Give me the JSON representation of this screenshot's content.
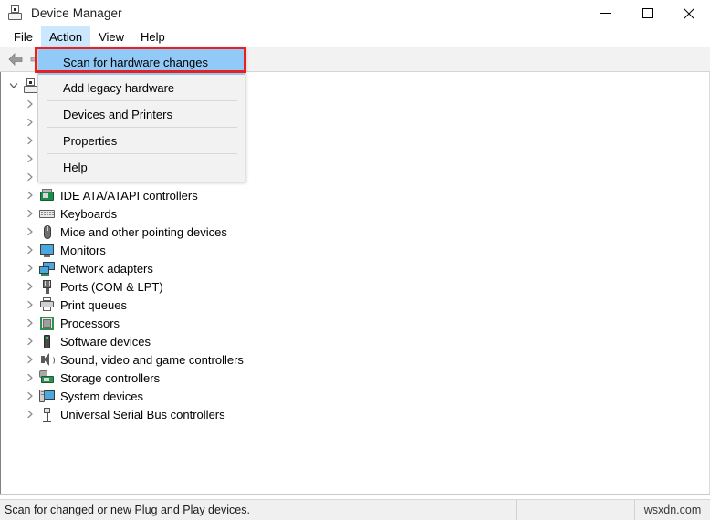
{
  "window": {
    "title": "Device Manager",
    "icon": "device-manager-icon",
    "controls": {
      "minimize": "Minimize",
      "maximize": "Maximize",
      "close": "Close"
    }
  },
  "menubar": {
    "items": [
      {
        "label": "File",
        "active": false
      },
      {
        "label": "Action",
        "active": true
      },
      {
        "label": "View",
        "active": false
      },
      {
        "label": "Help",
        "active": false
      }
    ]
  },
  "toolbar": {
    "buttons": [
      {
        "name": "back-button",
        "icon": "back-arrow-icon"
      },
      {
        "name": "forward-button",
        "icon": "forward-arrow-icon"
      }
    ]
  },
  "dropdown": {
    "owner": "Action",
    "items": [
      {
        "label": "Scan for hardware changes",
        "highlighted": true,
        "separator_after": false
      },
      {
        "label": "Add legacy hardware",
        "highlighted": false,
        "separator_after": true
      },
      {
        "label": "Devices and Printers",
        "highlighted": false,
        "separator_after": true
      },
      {
        "label": "Properties",
        "highlighted": false,
        "separator_after": true
      },
      {
        "label": "Help",
        "highlighted": false,
        "separator_after": false
      }
    ],
    "annotation_color": "#e8201f",
    "highlight_color": "#91c9f7"
  },
  "tree": {
    "root": {
      "label": "",
      "icon": "computer-icon",
      "expanded": true
    },
    "hidden_rows": 5,
    "items": [
      {
        "label": "IDE ATA/ATAPI controllers",
        "icon": "ide-controller-icon"
      },
      {
        "label": "Keyboards",
        "icon": "keyboard-icon"
      },
      {
        "label": "Mice and other pointing devices",
        "icon": "mouse-icon"
      },
      {
        "label": "Monitors",
        "icon": "monitor-icon"
      },
      {
        "label": "Network adapters",
        "icon": "network-adapter-icon"
      },
      {
        "label": "Ports (COM & LPT)",
        "icon": "port-icon"
      },
      {
        "label": "Print queues",
        "icon": "printer-icon"
      },
      {
        "label": "Processors",
        "icon": "processor-icon"
      },
      {
        "label": "Software devices",
        "icon": "software-device-icon"
      },
      {
        "label": "Sound, video and game controllers",
        "icon": "sound-icon"
      },
      {
        "label": "Storage controllers",
        "icon": "storage-controller-icon"
      },
      {
        "label": "System devices",
        "icon": "system-device-icon"
      },
      {
        "label": "Universal Serial Bus controllers",
        "icon": "usb-icon"
      }
    ]
  },
  "statusbar": {
    "message": "Scan for changed or new Plug and Play devices.",
    "middle": "",
    "watermark": "wsxdn.com"
  }
}
